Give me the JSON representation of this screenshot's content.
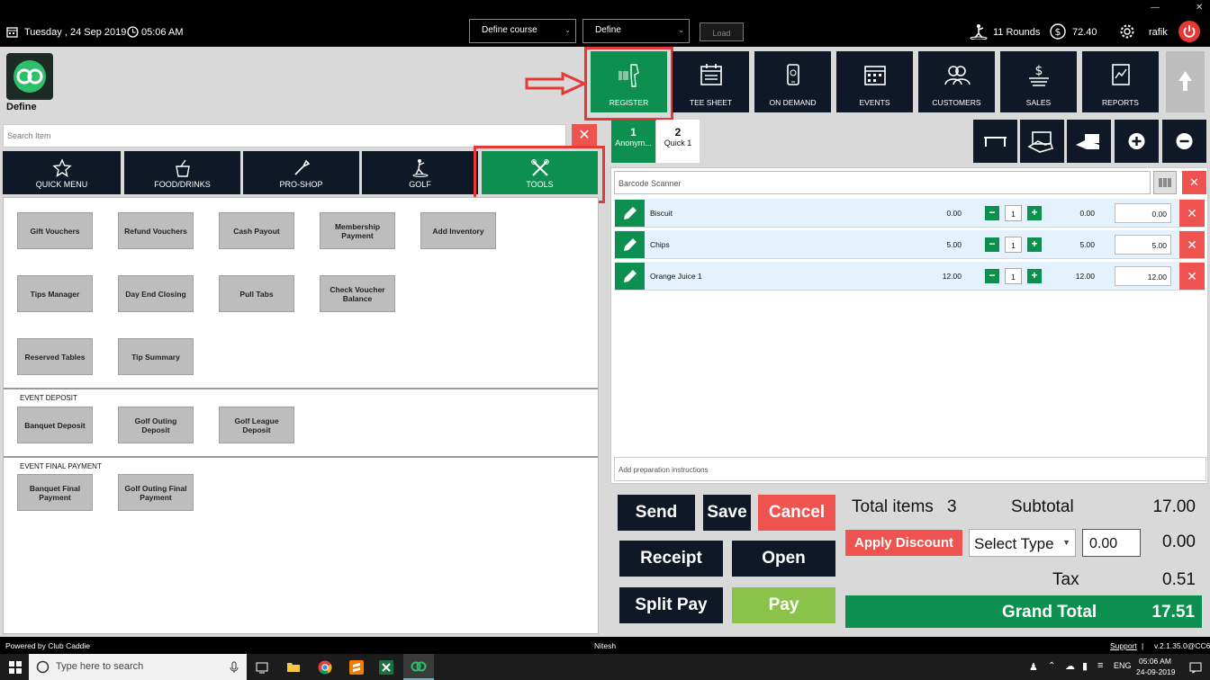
{
  "topbar": {
    "date": "Tuesday ,  24 Sep 2019",
    "time": "05:06 AM",
    "course_select": "Define course",
    "define_select": "Define",
    "load_label": "Load",
    "rounds": "11 Rounds",
    "balance": "72.40",
    "user": "rafik",
    "win_min": "—",
    "win_close": "✕"
  },
  "brand": {
    "name": "Define"
  },
  "nav": [
    {
      "label": "REGISTER",
      "icon": "barcode-scanner-icon"
    },
    {
      "label": "TEE SHEET",
      "icon": "calendar-list-icon"
    },
    {
      "label": "ON DEMAND",
      "icon": "mobile-icon"
    },
    {
      "label": "EVENTS",
      "icon": "calendar-icon"
    },
    {
      "label": "CUSTOMERS",
      "icon": "users-icon"
    },
    {
      "label": "SALES",
      "icon": "money-icon"
    },
    {
      "label": "REPORTS",
      "icon": "report-icon"
    }
  ],
  "search": {
    "placeholder": "Search Item"
  },
  "categories": [
    {
      "label": "QUICK MENU",
      "icon": "star-icon"
    },
    {
      "label": "FOOD/DRINKS",
      "icon": "drink-icon"
    },
    {
      "label": "PRO-SHOP",
      "icon": "tag-icon"
    },
    {
      "label": "GOLF",
      "icon": "golf-icon"
    },
    {
      "label": "TOOLS",
      "icon": "tools-icon"
    }
  ],
  "tools_tiles": [
    "Gift Vouchers",
    "Refund Vouchers",
    "Cash Payout",
    "Membership Payment",
    "Add Inventory",
    "Tips Manager",
    "Day End Closing",
    "Pull Tabs",
    "Check Voucher Balance",
    "Reserved Tables",
    "Tip Summary"
  ],
  "event_deposit": {
    "title": "EVENT DEPOSIT",
    "tiles": [
      "Banquet Deposit",
      "Golf Outing Deposit",
      "Golf League Deposit"
    ]
  },
  "event_final": {
    "title": "EVENT FINAL PAYMENT",
    "tiles": [
      "Banquet Final Payment",
      "Golf Outing Final Payment"
    ]
  },
  "tabs": [
    {
      "num": "1",
      "label": "Anonym..."
    },
    {
      "num": "2",
      "label": "Quick 1"
    }
  ],
  "barcode": {
    "placeholder": "Barcode Scanner"
  },
  "cart_items": [
    {
      "name": "Biscuit",
      "price": "0.00",
      "qty": "1",
      "ext": "0.00",
      "total": "0.00"
    },
    {
      "name": "Chips",
      "price": "5.00",
      "qty": "1",
      "ext": "5.00",
      "total": "5.00"
    },
    {
      "name": "Orange Juice 1",
      "price": "12.00",
      "qty": "1",
      "ext": "12.00",
      "total": "12.00"
    }
  ],
  "prep": {
    "placeholder": "Add preparation instructions"
  },
  "actions": {
    "send": "Send",
    "save": "Save",
    "cancel": "Cancel",
    "receipt": "Receipt",
    "open": "Open",
    "split_pay": "Split Pay",
    "pay": "Pay",
    "apply_discount": "Apply Discount"
  },
  "summary": {
    "total_items_label": "Total items",
    "total_items": "3",
    "subtotal_label": "Subtotal",
    "subtotal": "17.00",
    "select_type": "Select Type",
    "discount_input": "0.00",
    "discount": "0.00",
    "tax_label": "Tax",
    "tax": "0.51",
    "grand_total_label": "Grand Total",
    "grand_total": "17.51"
  },
  "footer": {
    "powered": "Powered by Club Caddie",
    "user": "Nitesh",
    "support": "Support",
    "version": "v.2.1.35.0@CC6"
  },
  "taskbar": {
    "search": "Type here to search",
    "lang": "ENG",
    "time": "05:06 AM",
    "date": "24-09-2019"
  },
  "colors": {
    "green": "#0d8f4f",
    "navy": "#0f1826",
    "red": "#ef5350",
    "highlight": "#e53935"
  }
}
